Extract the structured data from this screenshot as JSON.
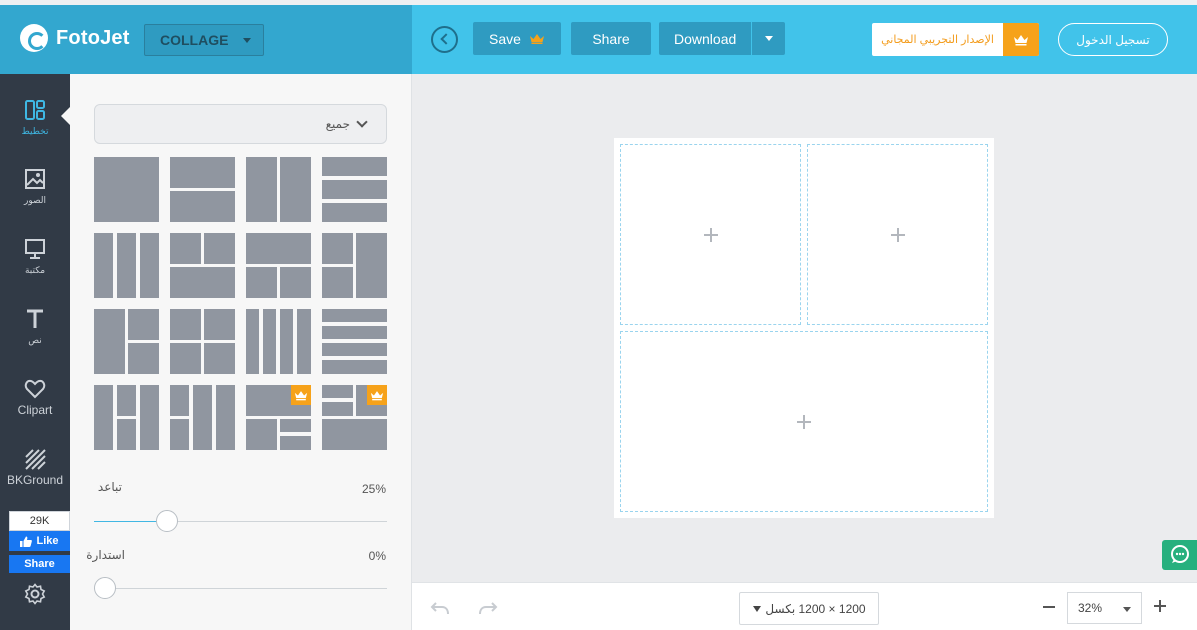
{
  "header": {
    "logo_text": "FotoJet",
    "collage_select": "COLLAGE",
    "save_label": "Save",
    "share_label": "Share",
    "download_label": "Download",
    "trial_label": "الإصدار التجريبي المجاني",
    "login_label": "تسجيل الدخول"
  },
  "colors": {
    "accent": "#41c3ea",
    "accent_dark": "#33a7cf",
    "premium": "#f6a21a",
    "sidebar": "#313a46",
    "tile": "#9096a0"
  },
  "sidebar": {
    "items": [
      {
        "label": "تخطيط",
        "icon": "layout-icon",
        "active": true
      },
      {
        "label": "الصور",
        "icon": "image-icon",
        "active": false
      },
      {
        "label": "مكتبة",
        "icon": "monitor-icon",
        "active": false
      },
      {
        "label": "نص",
        "icon": "text-icon",
        "active": false
      },
      {
        "label": "Clipart",
        "icon": "heart-icon",
        "active": false
      },
      {
        "label": "BKGround",
        "icon": "background-icon",
        "active": false
      }
    ],
    "facebook": {
      "count": "29K",
      "like_label": "Like",
      "share_label": "Share"
    },
    "settings_icon": "gear-icon"
  },
  "panel": {
    "filter_label": "جميع",
    "tiles_count_note": "16",
    "spacing": {
      "label": "تباعد",
      "value": "25%",
      "level": 0.25
    },
    "roundness": {
      "label": "استدارة",
      "value": "0%",
      "level": 0
    }
  },
  "footer": {
    "canvas_size": "1200 × 1200 بكسل",
    "zoom": "32%"
  }
}
